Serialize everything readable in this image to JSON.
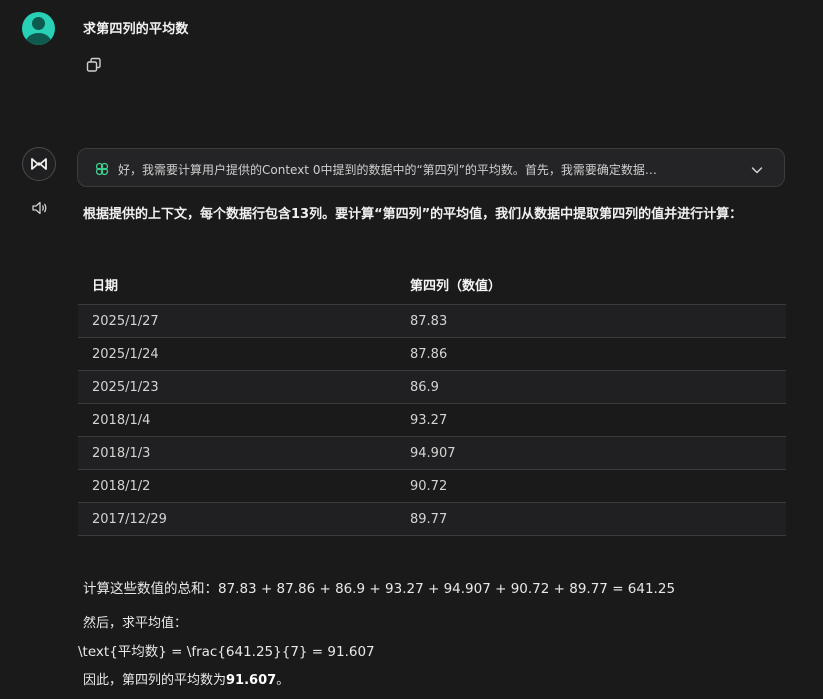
{
  "user": {
    "message": "求第四列的平均数"
  },
  "thinking": {
    "summary": "好，我需要计算用户提供的Context 0中提到的数据中的“第四列”的平均数。首先，我需要确定数据…"
  },
  "answer": {
    "intro": "根据提供的上下文，每个数据行包含13列。要计算“第四列”的平均值，我们从数据中提取第四列的值并进行计算：",
    "table": {
      "headers": [
        "日期",
        "第四列（数值）"
      ],
      "rows": [
        [
          "2025/1/27",
          "87.83"
        ],
        [
          "2025/1/24",
          "87.86"
        ],
        [
          "2025/1/23",
          "86.9"
        ],
        [
          "2018/1/4",
          "93.27"
        ],
        [
          "2018/1/3",
          "94.907"
        ],
        [
          "2018/1/2",
          "90.72"
        ],
        [
          "2017/12/29",
          "89.77"
        ]
      ]
    },
    "sum_label": "计算这些数值的总和：",
    "sum_expression": "87.83 + 87.86 + 86.9 + 93.27 + 94.907 + 90.72 + 89.77 = 641.25",
    "then_text": "然后，求平均值：",
    "formula": "\\text{平均数} = \\frac{641.25}{7} = 91.607",
    "result_prefix": "因此，第四列的平均数为",
    "result_value": "91.607",
    "result_suffix": "。"
  },
  "icons": {
    "copy": "copy-icon",
    "speaker": "speaker-icon",
    "brain": "brain-icon",
    "chevron": "chevron-down-icon",
    "ai_logo": "infinity-logo-icon"
  },
  "colors": {
    "background": "#1a1a1b",
    "avatar": "#28d1b6",
    "brain_icon": "#3fcf8e"
  }
}
